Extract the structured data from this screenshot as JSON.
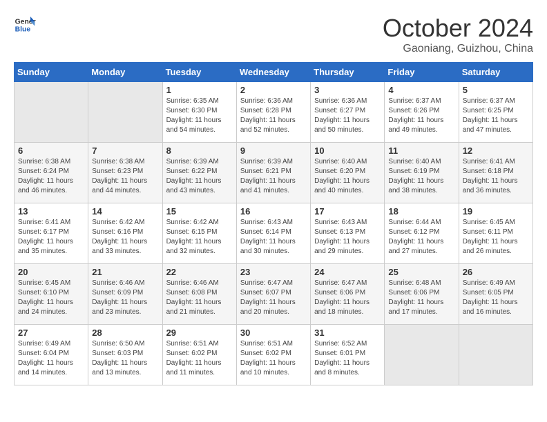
{
  "logo": {
    "line1": "General",
    "line2": "Blue"
  },
  "title": "October 2024",
  "location": "Gaoniang, Guizhou, China",
  "weekdays": [
    "Sunday",
    "Monday",
    "Tuesday",
    "Wednesday",
    "Thursday",
    "Friday",
    "Saturday"
  ],
  "weeks": [
    [
      {
        "day": "",
        "sunrise": "",
        "sunset": "",
        "daylight": ""
      },
      {
        "day": "",
        "sunrise": "",
        "sunset": "",
        "daylight": ""
      },
      {
        "day": "1",
        "sunrise": "Sunrise: 6:35 AM",
        "sunset": "Sunset: 6:30 PM",
        "daylight": "Daylight: 11 hours and 54 minutes."
      },
      {
        "day": "2",
        "sunrise": "Sunrise: 6:36 AM",
        "sunset": "Sunset: 6:28 PM",
        "daylight": "Daylight: 11 hours and 52 minutes."
      },
      {
        "day": "3",
        "sunrise": "Sunrise: 6:36 AM",
        "sunset": "Sunset: 6:27 PM",
        "daylight": "Daylight: 11 hours and 50 minutes."
      },
      {
        "day": "4",
        "sunrise": "Sunrise: 6:37 AM",
        "sunset": "Sunset: 6:26 PM",
        "daylight": "Daylight: 11 hours and 49 minutes."
      },
      {
        "day": "5",
        "sunrise": "Sunrise: 6:37 AM",
        "sunset": "Sunset: 6:25 PM",
        "daylight": "Daylight: 11 hours and 47 minutes."
      }
    ],
    [
      {
        "day": "6",
        "sunrise": "Sunrise: 6:38 AM",
        "sunset": "Sunset: 6:24 PM",
        "daylight": "Daylight: 11 hours and 46 minutes."
      },
      {
        "day": "7",
        "sunrise": "Sunrise: 6:38 AM",
        "sunset": "Sunset: 6:23 PM",
        "daylight": "Daylight: 11 hours and 44 minutes."
      },
      {
        "day": "8",
        "sunrise": "Sunrise: 6:39 AM",
        "sunset": "Sunset: 6:22 PM",
        "daylight": "Daylight: 11 hours and 43 minutes."
      },
      {
        "day": "9",
        "sunrise": "Sunrise: 6:39 AM",
        "sunset": "Sunset: 6:21 PM",
        "daylight": "Daylight: 11 hours and 41 minutes."
      },
      {
        "day": "10",
        "sunrise": "Sunrise: 6:40 AM",
        "sunset": "Sunset: 6:20 PM",
        "daylight": "Daylight: 11 hours and 40 minutes."
      },
      {
        "day": "11",
        "sunrise": "Sunrise: 6:40 AM",
        "sunset": "Sunset: 6:19 PM",
        "daylight": "Daylight: 11 hours and 38 minutes."
      },
      {
        "day": "12",
        "sunrise": "Sunrise: 6:41 AM",
        "sunset": "Sunset: 6:18 PM",
        "daylight": "Daylight: 11 hours and 36 minutes."
      }
    ],
    [
      {
        "day": "13",
        "sunrise": "Sunrise: 6:41 AM",
        "sunset": "Sunset: 6:17 PM",
        "daylight": "Daylight: 11 hours and 35 minutes."
      },
      {
        "day": "14",
        "sunrise": "Sunrise: 6:42 AM",
        "sunset": "Sunset: 6:16 PM",
        "daylight": "Daylight: 11 hours and 33 minutes."
      },
      {
        "day": "15",
        "sunrise": "Sunrise: 6:42 AM",
        "sunset": "Sunset: 6:15 PM",
        "daylight": "Daylight: 11 hours and 32 minutes."
      },
      {
        "day": "16",
        "sunrise": "Sunrise: 6:43 AM",
        "sunset": "Sunset: 6:14 PM",
        "daylight": "Daylight: 11 hours and 30 minutes."
      },
      {
        "day": "17",
        "sunrise": "Sunrise: 6:43 AM",
        "sunset": "Sunset: 6:13 PM",
        "daylight": "Daylight: 11 hours and 29 minutes."
      },
      {
        "day": "18",
        "sunrise": "Sunrise: 6:44 AM",
        "sunset": "Sunset: 6:12 PM",
        "daylight": "Daylight: 11 hours and 27 minutes."
      },
      {
        "day": "19",
        "sunrise": "Sunrise: 6:45 AM",
        "sunset": "Sunset: 6:11 PM",
        "daylight": "Daylight: 11 hours and 26 minutes."
      }
    ],
    [
      {
        "day": "20",
        "sunrise": "Sunrise: 6:45 AM",
        "sunset": "Sunset: 6:10 PM",
        "daylight": "Daylight: 11 hours and 24 minutes."
      },
      {
        "day": "21",
        "sunrise": "Sunrise: 6:46 AM",
        "sunset": "Sunset: 6:09 PM",
        "daylight": "Daylight: 11 hours and 23 minutes."
      },
      {
        "day": "22",
        "sunrise": "Sunrise: 6:46 AM",
        "sunset": "Sunset: 6:08 PM",
        "daylight": "Daylight: 11 hours and 21 minutes."
      },
      {
        "day": "23",
        "sunrise": "Sunrise: 6:47 AM",
        "sunset": "Sunset: 6:07 PM",
        "daylight": "Daylight: 11 hours and 20 minutes."
      },
      {
        "day": "24",
        "sunrise": "Sunrise: 6:47 AM",
        "sunset": "Sunset: 6:06 PM",
        "daylight": "Daylight: 11 hours and 18 minutes."
      },
      {
        "day": "25",
        "sunrise": "Sunrise: 6:48 AM",
        "sunset": "Sunset: 6:06 PM",
        "daylight": "Daylight: 11 hours and 17 minutes."
      },
      {
        "day": "26",
        "sunrise": "Sunrise: 6:49 AM",
        "sunset": "Sunset: 6:05 PM",
        "daylight": "Daylight: 11 hours and 16 minutes."
      }
    ],
    [
      {
        "day": "27",
        "sunrise": "Sunrise: 6:49 AM",
        "sunset": "Sunset: 6:04 PM",
        "daylight": "Daylight: 11 hours and 14 minutes."
      },
      {
        "day": "28",
        "sunrise": "Sunrise: 6:50 AM",
        "sunset": "Sunset: 6:03 PM",
        "daylight": "Daylight: 11 hours and 13 minutes."
      },
      {
        "day": "29",
        "sunrise": "Sunrise: 6:51 AM",
        "sunset": "Sunset: 6:02 PM",
        "daylight": "Daylight: 11 hours and 11 minutes."
      },
      {
        "day": "30",
        "sunrise": "Sunrise: 6:51 AM",
        "sunset": "Sunset: 6:02 PM",
        "daylight": "Daylight: 11 hours and 10 minutes."
      },
      {
        "day": "31",
        "sunrise": "Sunrise: 6:52 AM",
        "sunset": "Sunset: 6:01 PM",
        "daylight": "Daylight: 11 hours and 8 minutes."
      },
      {
        "day": "",
        "sunrise": "",
        "sunset": "",
        "daylight": ""
      },
      {
        "day": "",
        "sunrise": "",
        "sunset": "",
        "daylight": ""
      }
    ]
  ]
}
